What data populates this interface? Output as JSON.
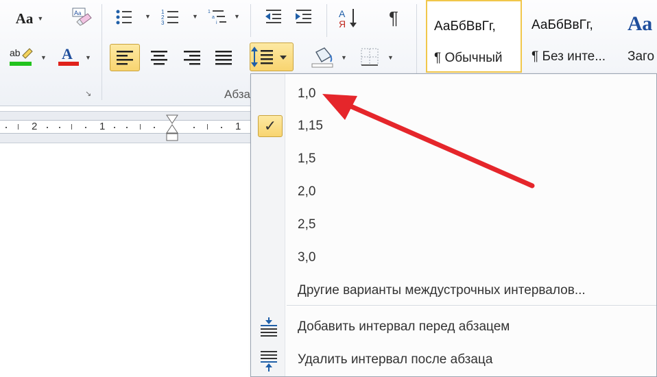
{
  "ribbon": {
    "font_group": {
      "change_case_label": "Aa",
      "clear_format_icon": "eraser-icon",
      "highlight_label": "ab",
      "highlight_color": "#22c31e",
      "font_color_label": "A",
      "font_color": "#e0221b"
    },
    "paragraph_group": {
      "label": "Абзац",
      "launcher_glyph": "↘"
    },
    "styles": [
      {
        "sample": "АаБбВвГг,",
        "name": "¶ Обычный",
        "selected": true
      },
      {
        "sample": "АаБбВвГг,",
        "name": "¶ Без инте..."
      },
      {
        "sample": "Аа",
        "name": "Заго"
      }
    ]
  },
  "ruler": {
    "numbers": [
      "2",
      "1",
      "1"
    ]
  },
  "line_spacing_menu": {
    "options": [
      "1,0",
      "1,15",
      "1,5",
      "2,0",
      "2,5",
      "3,0"
    ],
    "checked": "1,15",
    "more_options": "Другие варианты междустрочных интервалов...",
    "add_before": "Добавить интервал перед абзацем",
    "remove_after": "Удалить интервал после абзаца"
  },
  "annotation": {
    "arrow_color": "#e5262b"
  }
}
